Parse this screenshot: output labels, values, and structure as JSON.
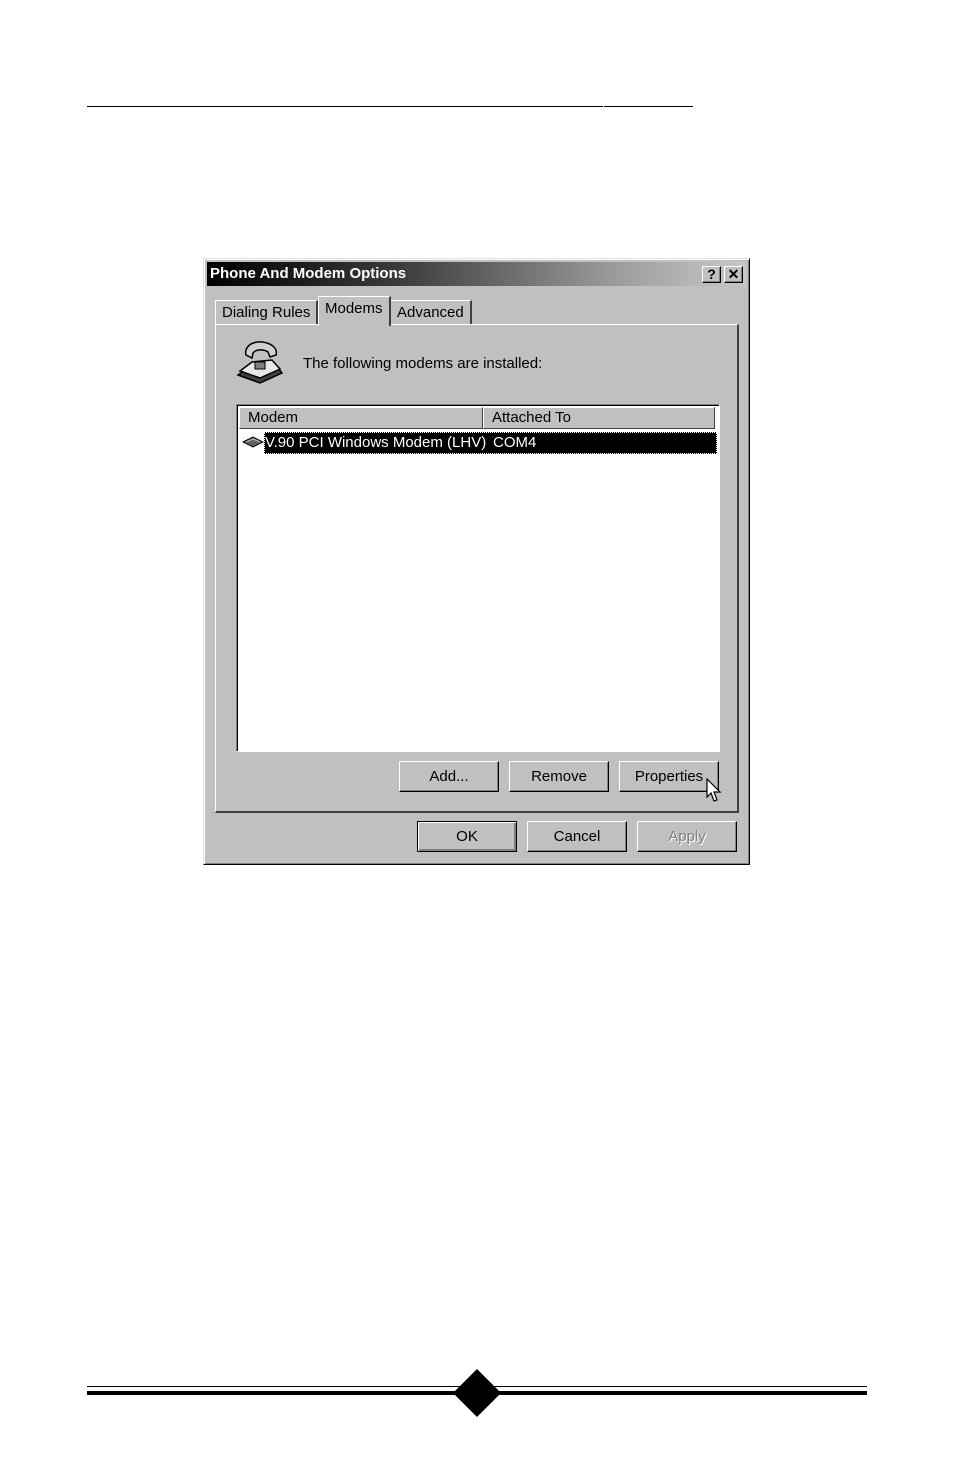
{
  "window": {
    "title": "Phone And Modem Options",
    "help_label": "?",
    "close_label": "✕"
  },
  "tabs": [
    {
      "label": "Dialing Rules",
      "active": false
    },
    {
      "label": "Modems",
      "active": true
    },
    {
      "label": "Advanced",
      "active": false
    }
  ],
  "modems_tab": {
    "installed_label": "The following modems are  installed:",
    "columns": [
      "Modem",
      "Attached To"
    ],
    "rows": [
      {
        "modem": "V.90 PCI Windows Modem (LHV)",
        "attached_to": "COM4",
        "selected": true
      }
    ],
    "buttons": {
      "add": "Add...",
      "remove": "Remove",
      "properties": "Properties"
    }
  },
  "footer_buttons": {
    "ok": "OK",
    "cancel": "Cancel",
    "apply": "Apply"
  },
  "colors": {
    "dialog_face": "#c0c0c0",
    "selection": "#000000",
    "disabled_text": "#808080"
  },
  "icons": [
    "phone-icon",
    "modem-icon",
    "mouse-cursor-icon"
  ]
}
